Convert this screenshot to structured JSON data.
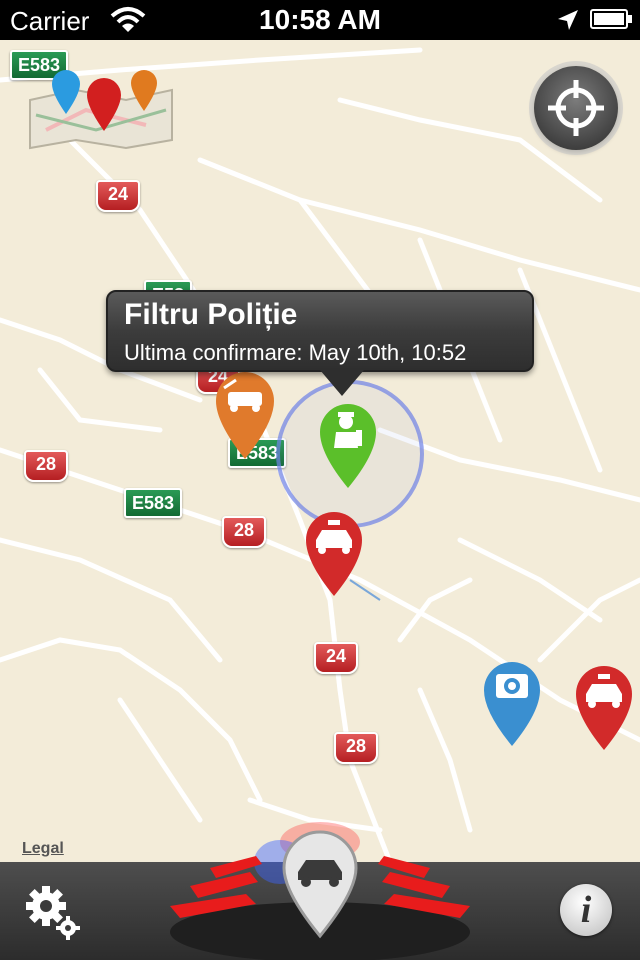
{
  "status_bar": {
    "carrier": "Carrier",
    "time": "10:58 AM"
  },
  "map": {
    "legal": "Legal",
    "road_signs": {
      "e583_top": "E583",
      "r24_a": "24",
      "e58_partial": "E58",
      "r24_b": "24",
      "r28_a": "28",
      "e583_mid": "E583",
      "e583_left": "E583",
      "r28_b": "28",
      "r24_c": "24",
      "r28_c": "28"
    }
  },
  "callout": {
    "title": "Filtru Poliție",
    "subtitle": "Ultima confirmare:  May 10th, 10:52"
  },
  "icons": {
    "map_legend": "map-legend-icon",
    "locate": "crosshair-icon",
    "settings": "gears-icon",
    "info": "info-icon",
    "report": "car-report-icon"
  },
  "colors": {
    "police_green": "#5bbf2a",
    "police_red": "#d22a2a",
    "tow_orange": "#e07a2c",
    "camera_blue": "#3a8fd0"
  }
}
